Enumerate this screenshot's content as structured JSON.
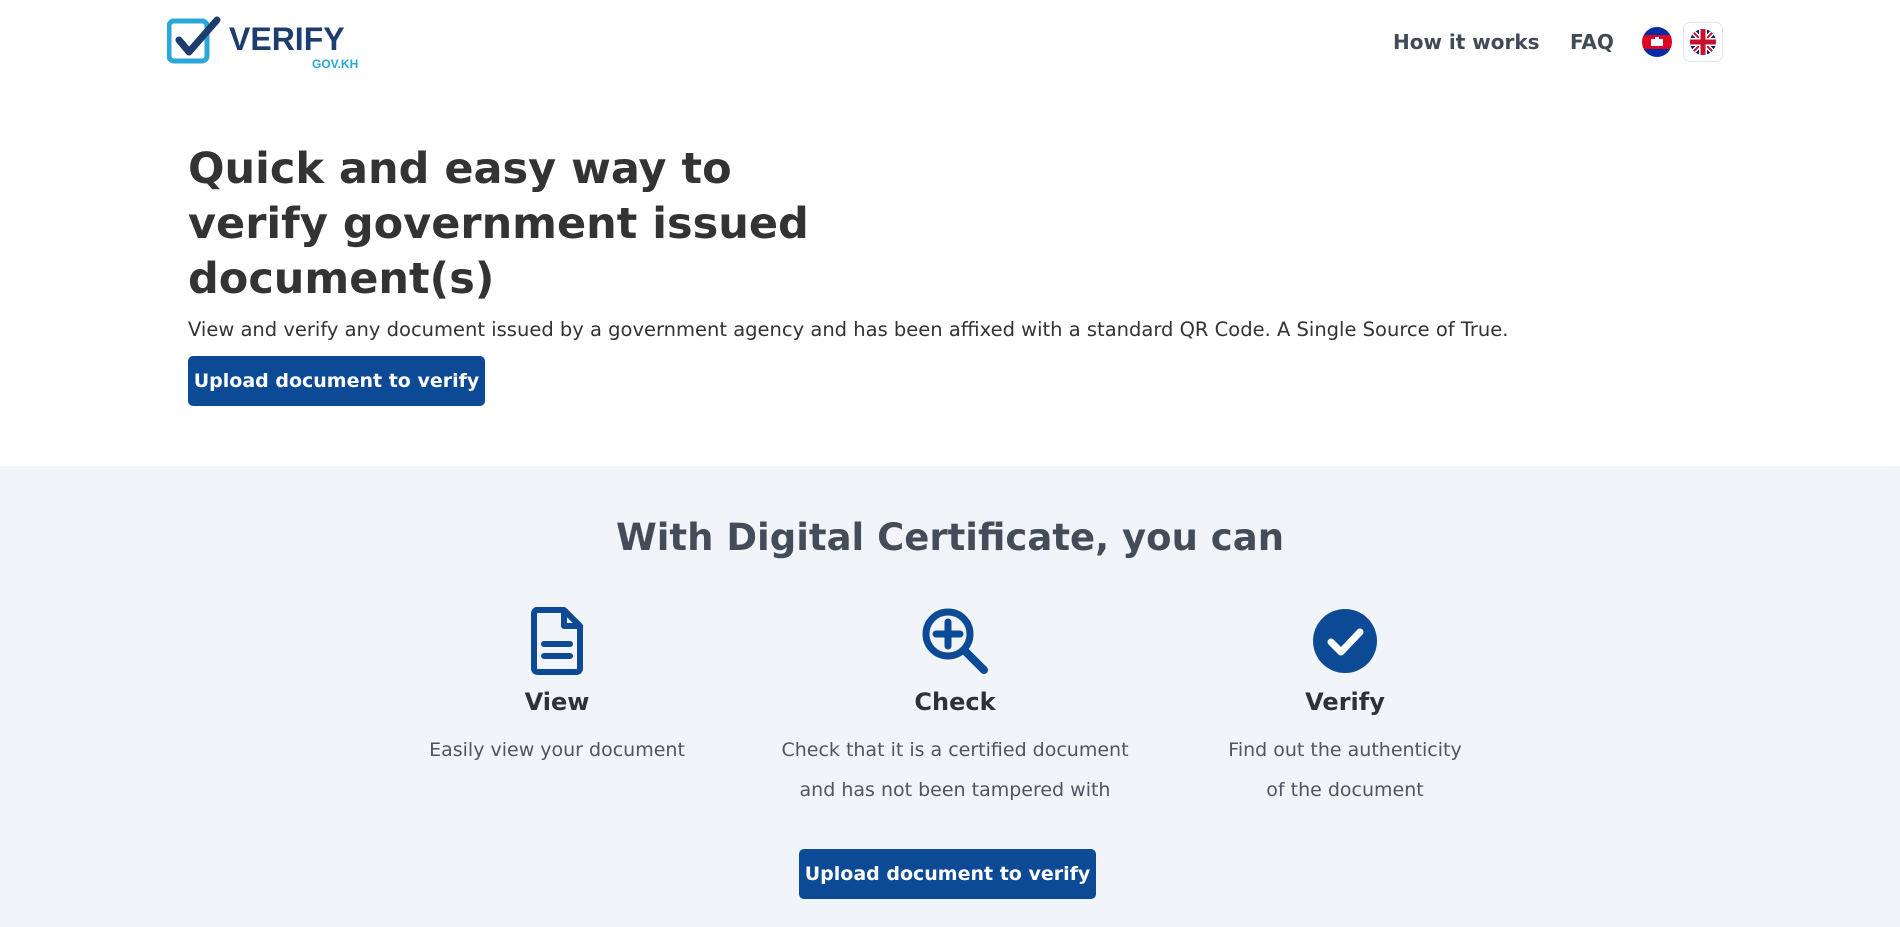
{
  "brand": {
    "logo_text": "VERIFY",
    "logo_domain": "GOV.KH",
    "colors": {
      "primary": "#0c4a96",
      "accent": "#2ba6d9",
      "dark": "#1c3d6e"
    }
  },
  "nav": {
    "how_it_works": "How it works",
    "faq": "FAQ",
    "languages": [
      "khmer-flag-icon",
      "uk-flag-icon"
    ]
  },
  "hero": {
    "title": "Quick and easy way to verify government issued document(s)",
    "subtitle": "View and verify any document issued by a government agency and has been affixed with a standard QR Code. A Single Source of True.",
    "cta": "Upload document to verify"
  },
  "features": {
    "title": "With Digital Certificate, you can",
    "items": [
      {
        "icon": "document-icon",
        "name": "View",
        "desc_line1": "Easily view your document",
        "desc_line2": ""
      },
      {
        "icon": "magnify-plus-icon",
        "name": "Check",
        "desc_line1": "Check that it is a certified document",
        "desc_line2": "and has not been tampered with"
      },
      {
        "icon": "check-circle-icon",
        "name": "Verify",
        "desc_line1": "Find out the authenticity",
        "desc_line2": "of the document"
      }
    ],
    "cta": "Upload document to verify"
  }
}
